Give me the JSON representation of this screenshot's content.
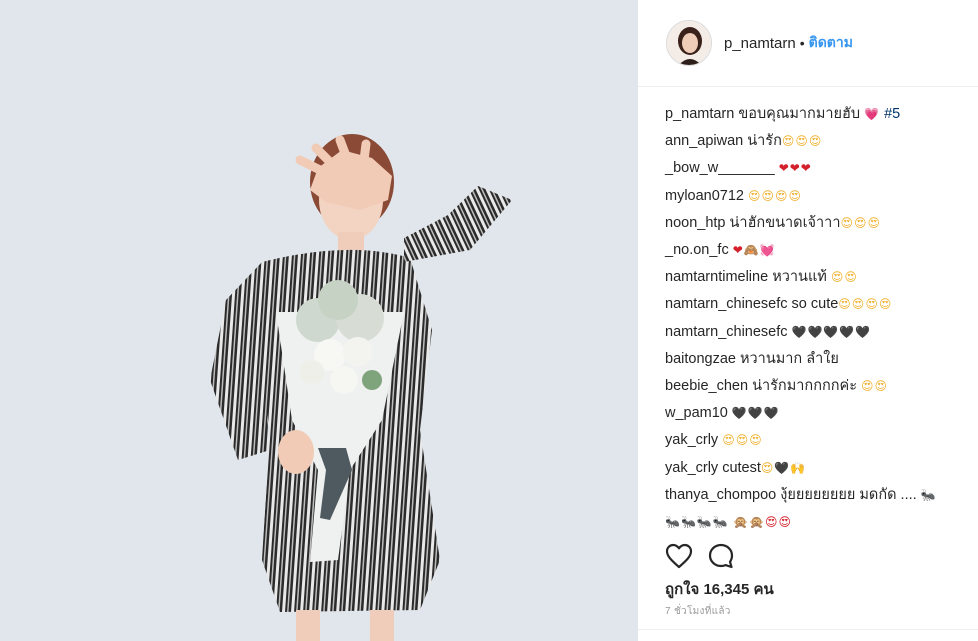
{
  "post": {
    "username": "p_namtarn",
    "separator": "•",
    "follow_label": "ติดตาม"
  },
  "comments": [
    {
      "user": "p_namtarn",
      "text": " ขอบคุณมากมายฮับ ",
      "emoji": "💗",
      "extra": " #5"
    },
    {
      "user": "ann_apiwan",
      "text": " น่ารัก",
      "emoji": "😍😍😍"
    },
    {
      "user": "_bow_w_______",
      "text": " ",
      "emoji": "❤❤❤"
    },
    {
      "user": "myloan0712",
      "text": " ",
      "emoji": "😍😍😍😍"
    },
    {
      "user": "noon_htp",
      "text": " น่าฮักขนาดเจ้าาา",
      "emoji": "😍😍😍"
    },
    {
      "user": "_no.on_fc",
      "text": " ",
      "emoji": "❤🙈💓"
    },
    {
      "user": "namtarntimeline",
      "text": " หวานแท้ ",
      "emoji": "😍😍"
    },
    {
      "user": "namtarn_chinesefc",
      "text": " so cute",
      "emoji": "😍😍😍😍"
    },
    {
      "user": "namtarn_chinesefc",
      "text": " ",
      "emoji": "🖤🖤🖤🖤🖤"
    },
    {
      "user": "baitongzae",
      "text": " หวานมาก ลำใย",
      "emoji": ""
    },
    {
      "user": "beebie_chen",
      "text": " น่ารักมากกกกค่ะ ",
      "emoji": "😍😍"
    },
    {
      "user": "w_pam10",
      "text": " ",
      "emoji": "🖤🖤🖤"
    },
    {
      "user": "yak_crly",
      "text": " ",
      "emoji": "😍😍😍"
    },
    {
      "user": "yak_crly",
      "text": " cutest",
      "emoji": "😍🖤🙌"
    },
    {
      "user": "thanya_chompoo",
      "text": " งุ้ยยยยยยยย มดกัด .... ",
      "emoji": "🐜",
      "line2": "🐜🐜🐜🐜 🙊🙊😍😍"
    }
  ],
  "icons": {
    "like": "heart-outline-icon",
    "comment": "comment-bubble-icon"
  },
  "likes_text": "ถูกใจ 16,345 คน",
  "time_text": "7 ชั่วโมงที่แล้ว"
}
